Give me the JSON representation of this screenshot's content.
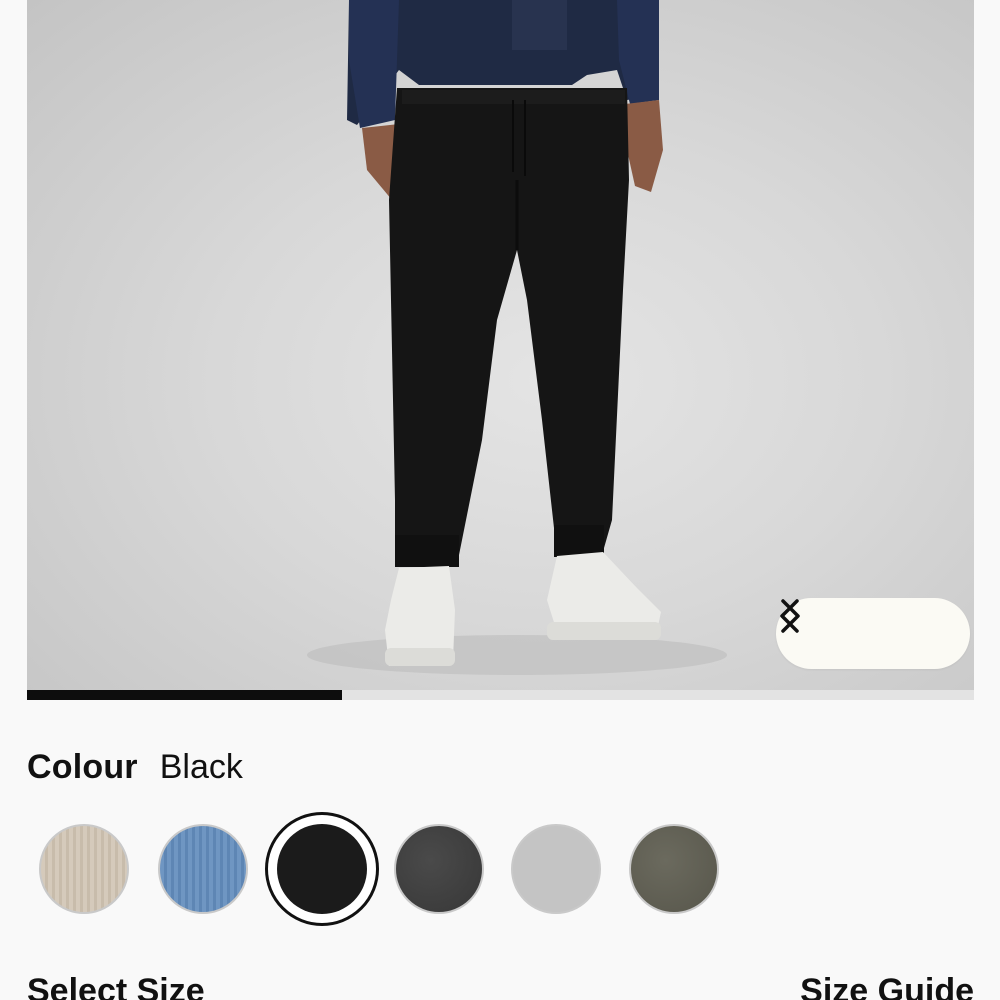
{
  "product": {
    "image_alt": "Model wearing black jogger pants with navy jacket and white sneakers",
    "carousel": {
      "prev_icon": "chevron-left-icon",
      "next_icon": "chevron-right-icon",
      "progress": 0.333
    }
  },
  "colour": {
    "label": "Colour",
    "selected": "Black",
    "swatches": [
      {
        "name": "beige-rib",
        "color": "#d5cabb"
      },
      {
        "name": "blue-rib",
        "color": "#6f96c2"
      },
      {
        "name": "black",
        "color": "#1b1b1b",
        "selected": true
      },
      {
        "name": "dark-heather-grey",
        "color": "#3f3f3f"
      },
      {
        "name": "light-grey",
        "color": "#c4c4c4"
      },
      {
        "name": "olive-heather",
        "color": "#5f5e53"
      }
    ]
  },
  "size": {
    "label": "Select Size",
    "guide_label": "Size Guide"
  }
}
